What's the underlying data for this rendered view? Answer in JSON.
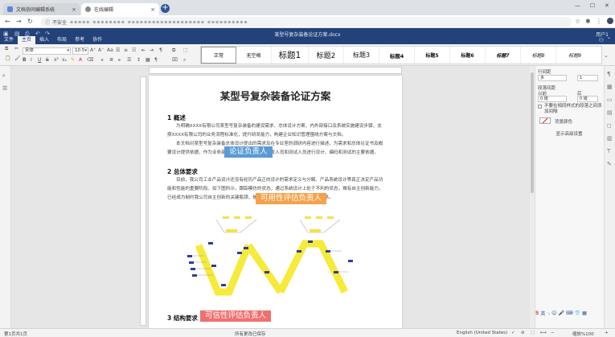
{
  "browser": {
    "tabs": [
      {
        "title": "文档协同编辑系统"
      },
      {
        "title": "在线编辑"
      }
    ],
    "insecure_label": "不安全",
    "url_masked": "▪▪▪▪▪ ▪▪▪▪▪▪▪▪ ▪▪▪▪▪▪▪▪▪▪▪▪▪▪▪▪▪▪▪ ▪▪▪▪▪▪▪▪▪▪"
  },
  "app": {
    "doc_title": "某型号复杂装备论证方案.docx",
    "user_label": "用户1",
    "menu": [
      "文件",
      "主页",
      "插入",
      "布局",
      "参考",
      "协作"
    ],
    "active_menu": "主页"
  },
  "ribbon": {
    "font_name": "宋体",
    "font_size": "10.5",
    "styles": [
      "正常",
      "无空格",
      "标题1",
      "标题2",
      "标题3",
      "标题4",
      "标题5",
      "标题6",
      "标题7",
      "标题8",
      "标题9"
    ],
    "selected_style": "正常"
  },
  "document": {
    "title": "某型号复杂装备论证方案",
    "sections": [
      {
        "heading": "1 概述",
        "paragraphs": [
          "为明确XXXX有限公司某型号复杂装备的建设需求、总体设计方案、内外部接口及系统实施建设步骤，支撑XXXX有限公司的业务流程标准化，提升研发能力，构建企业知识管理围绕方案与文档。",
          "本文档对某型号复杂装备总体设计提出的需求及在专业室的调研内容进行描述，为需求和总体论证书及概要设计提供依据，作为业务部门、实施计划、设计开发人员和测试人员进行设计、编码和测试的主要依据。"
        ]
      },
      {
        "heading": "2 总体要求",
        "paragraphs": [
          "目前，我公司工业产品设计还没有经历产品正向设计的需求定义与分解、产品系统设计等真正决定产品功能和性能的重要阶段。如下图所示，跟踪模仿的状态，通过系统设计上处于不利的状态，难有自主创新能力，已经成为制约我公司自主创新的关键瓶颈，是最建立基于系统工程的正向设计体系。"
        ]
      },
      {
        "heading": "3 结构要求"
      }
    ],
    "overlays": {
      "blue": "论证负责人",
      "orange": "可用性评估负责人",
      "red": "可信性评估负责人"
    }
  },
  "right_panel": {
    "line_spacing_label": "行间距",
    "line_spacing_mode": "多",
    "line_spacing_value": "1",
    "para_spacing_label": "段落间距",
    "before_label": "以前",
    "after_label": "后",
    "before_value": "0 磅",
    "after_value": "0 磅",
    "no_space_same_style": "不要在相同样式的段落之间添加间隔",
    "bg_color_label": "背景颜色",
    "advanced_settings": "显示高级设置"
  },
  "statusbar": {
    "page_info": "第1页共1页",
    "save_status": "所有更改已保存",
    "language": "English (United States)",
    "zoom": "缩放%100"
  },
  "colors": {
    "app_header": "#23427a",
    "overlay_blue": "#5b9bd5",
    "overlay_orange": "#f5a24b",
    "overlay_red": "#f07070"
  }
}
